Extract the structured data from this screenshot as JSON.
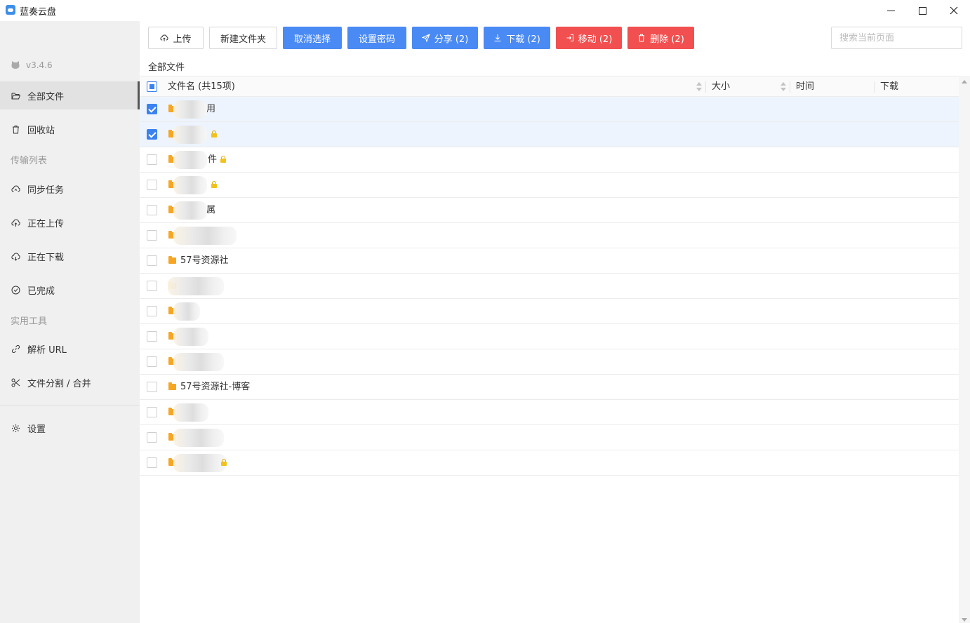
{
  "window": {
    "title": "蓝奏云盘"
  },
  "sidebar": {
    "version": "v3.4.6",
    "items": [
      {
        "label": "全部文件",
        "icon": "folder-open-icon"
      },
      {
        "label": "回收站",
        "icon": "trash-icon"
      },
      {
        "label": "同步任务",
        "icon": "cloud-sync-icon"
      },
      {
        "label": "正在上传",
        "icon": "cloud-upload-icon"
      },
      {
        "label": "正在下载",
        "icon": "cloud-download-icon"
      },
      {
        "label": "已完成",
        "icon": "check-circle-icon"
      },
      {
        "label": "解析 URL",
        "icon": "link-icon"
      },
      {
        "label": "文件分割 / 合并",
        "icon": "scissors-icon"
      },
      {
        "label": "设置",
        "icon": "gear-icon"
      }
    ],
    "groups": {
      "transfer": "传输列表",
      "tools": "实用工具"
    }
  },
  "toolbar": {
    "upload": "上传",
    "new_folder": "新建文件夹",
    "cancel_select": "取消选择",
    "set_password": "设置密码",
    "share": "分享 (2)",
    "download": "下载 (2)",
    "move": "移动 (2)",
    "delete": "删除 (2)",
    "search_placeholder": "搜索当前页面"
  },
  "breadcrumb": "全部文件",
  "table": {
    "headers": {
      "name": "文件名 (共15项)",
      "size": "大小",
      "time": "时间",
      "download": "下载"
    },
    "select_all_state": "indeterminate",
    "rows": [
      {
        "name": "用",
        "selected": true,
        "locked": false
      },
      {
        "name": "",
        "selected": true,
        "locked": true
      },
      {
        "name": "件",
        "selected": false,
        "locked": true
      },
      {
        "name": "",
        "selected": false,
        "locked": true
      },
      {
        "name": "属",
        "selected": false,
        "locked": false
      },
      {
        "name": "",
        "selected": false,
        "locked": false
      },
      {
        "name": "57号资源社",
        "selected": false,
        "locked": false
      },
      {
        "name": "",
        "selected": false,
        "locked": false
      },
      {
        "name": "",
        "selected": false,
        "locked": false
      },
      {
        "name": "",
        "selected": false,
        "locked": false
      },
      {
        "name": "",
        "selected": false,
        "locked": false
      },
      {
        "name": "57号资源社-博客",
        "selected": false,
        "locked": false
      },
      {
        "name": "",
        "selected": false,
        "locked": false
      },
      {
        "name": "",
        "selected": false,
        "locked": false
      },
      {
        "name": "",
        "selected": false,
        "locked": true
      }
    ]
  },
  "colors": {
    "primary": "#4a8af4",
    "danger": "#f25050",
    "folder": "#f6a623"
  }
}
